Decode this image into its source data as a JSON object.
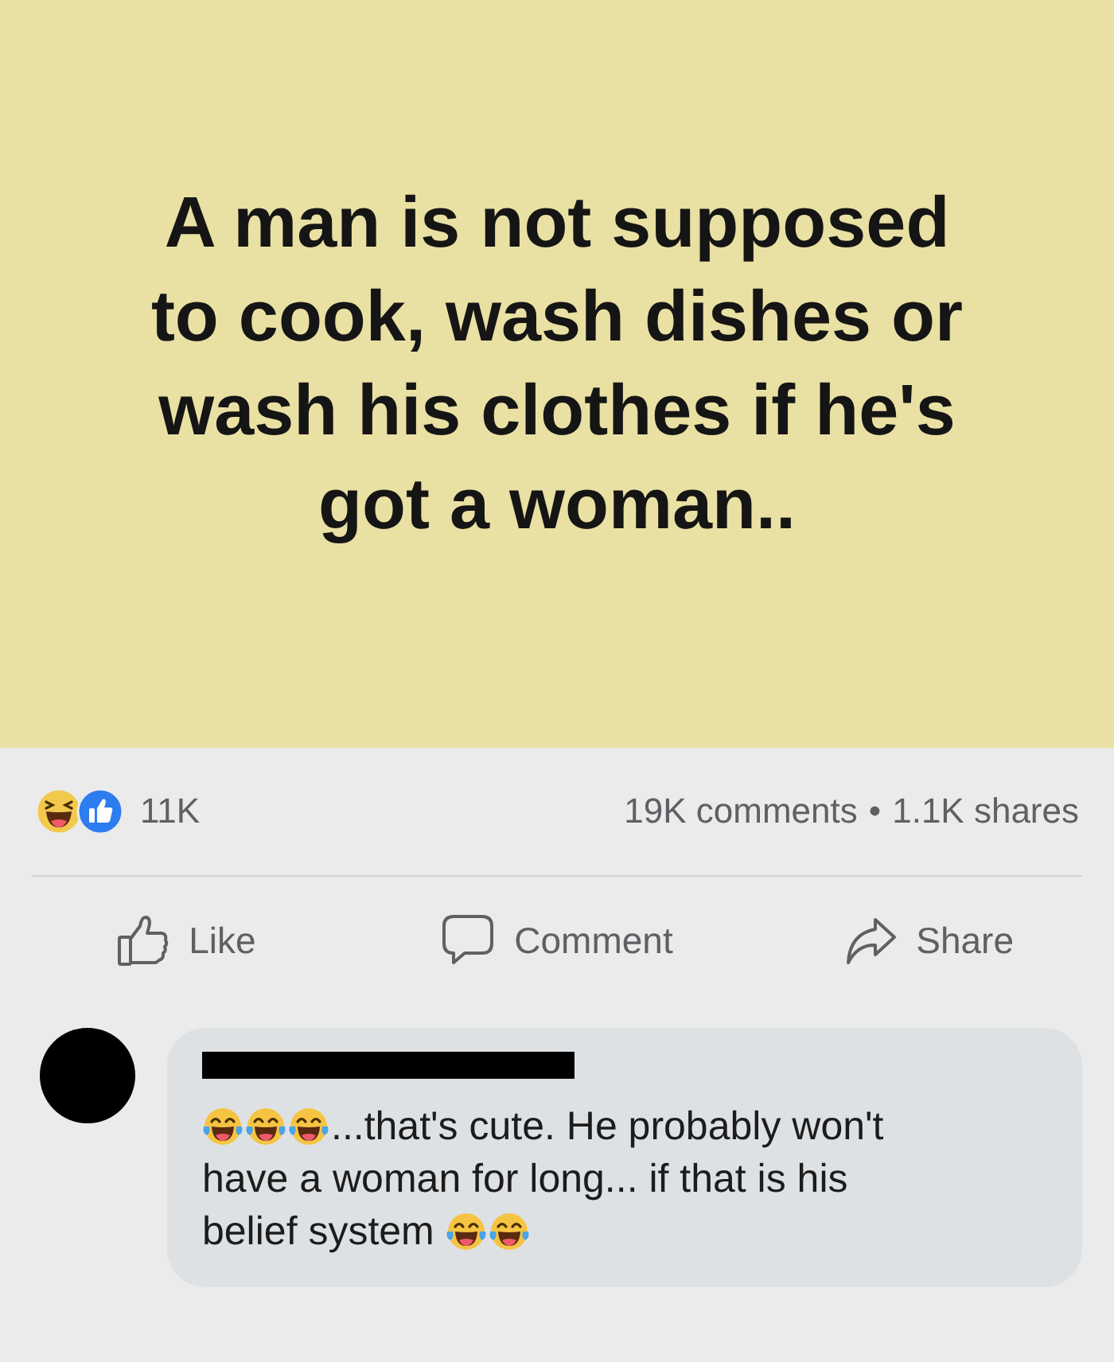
{
  "post": {
    "text": "A man is not supposed\nto cook, wash dishes or\nwash his clothes if he's\ngot a woman.."
  },
  "stats": {
    "reactions": [
      {
        "kind": "haha"
      },
      {
        "kind": "like"
      }
    ],
    "reaction_count": "11K",
    "comments": "19K comments",
    "separator": "•",
    "shares": "1.1K shares"
  },
  "actions": [
    {
      "kind": "like",
      "label": "Like"
    },
    {
      "kind": "comment",
      "label": "Comment"
    },
    {
      "kind": "share",
      "label": "Share"
    }
  ],
  "comment": {
    "segments": [
      {
        "kind": "emoji"
      },
      {
        "kind": "emoji"
      },
      {
        "kind": "emoji"
      },
      {
        "kind": "text",
        "text": "...that's cute. He probably won't\nhave a woman for long... if that is his\nbelief system"
      },
      {
        "kind": "emoji"
      },
      {
        "kind": "emoji"
      }
    ]
  }
}
